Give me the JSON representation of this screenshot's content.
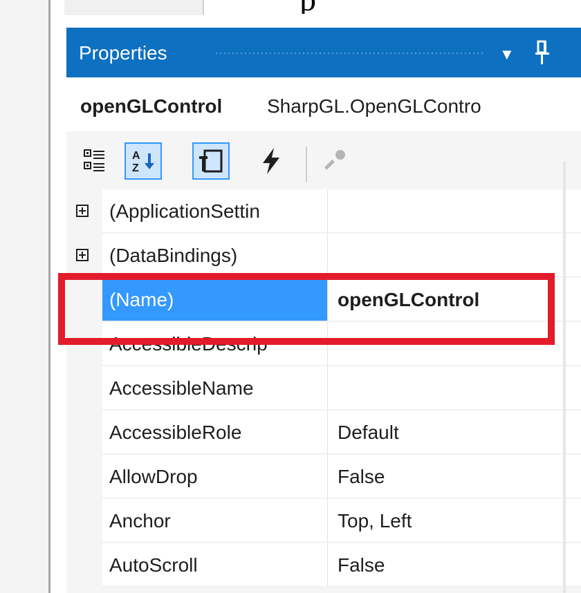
{
  "top_fragment": "p",
  "panel": {
    "title": "Properties",
    "dropdown_glyph": "▼",
    "pin_icon": "pin-icon"
  },
  "object": {
    "name": "openGLControl",
    "type": "SharpGL.OpenGLContro"
  },
  "toolbar": {
    "buttons": [
      {
        "icon": "categorized-icon",
        "checked": false
      },
      {
        "icon": "alphabetical-icon",
        "checked": true
      },
      {
        "icon": "properties-icon",
        "checked": true
      },
      {
        "icon": "events-icon",
        "checked": false
      },
      {
        "icon": "property-pages-icon",
        "checked": false,
        "disabled": true
      }
    ]
  },
  "rows": [
    {
      "name": "(ApplicationSettin",
      "value": "",
      "expandable": true
    },
    {
      "name": "(DataBindings)",
      "value": "",
      "expandable": true
    },
    {
      "name": "(Name)",
      "value": "openGLControl",
      "selected": true
    },
    {
      "name": "AccessibleDescrip",
      "value": ""
    },
    {
      "name": "AccessibleName",
      "value": ""
    },
    {
      "name": "AccessibleRole",
      "value": "Default"
    },
    {
      "name": "AllowDrop",
      "value": "False"
    },
    {
      "name": "Anchor",
      "value": "Top, Left"
    },
    {
      "name": "AutoScroll",
      "value": "False"
    }
  ],
  "colors": {
    "titlebar": "#0e70c0",
    "selection": "#3399ff",
    "highlight": "#e21c2b"
  }
}
